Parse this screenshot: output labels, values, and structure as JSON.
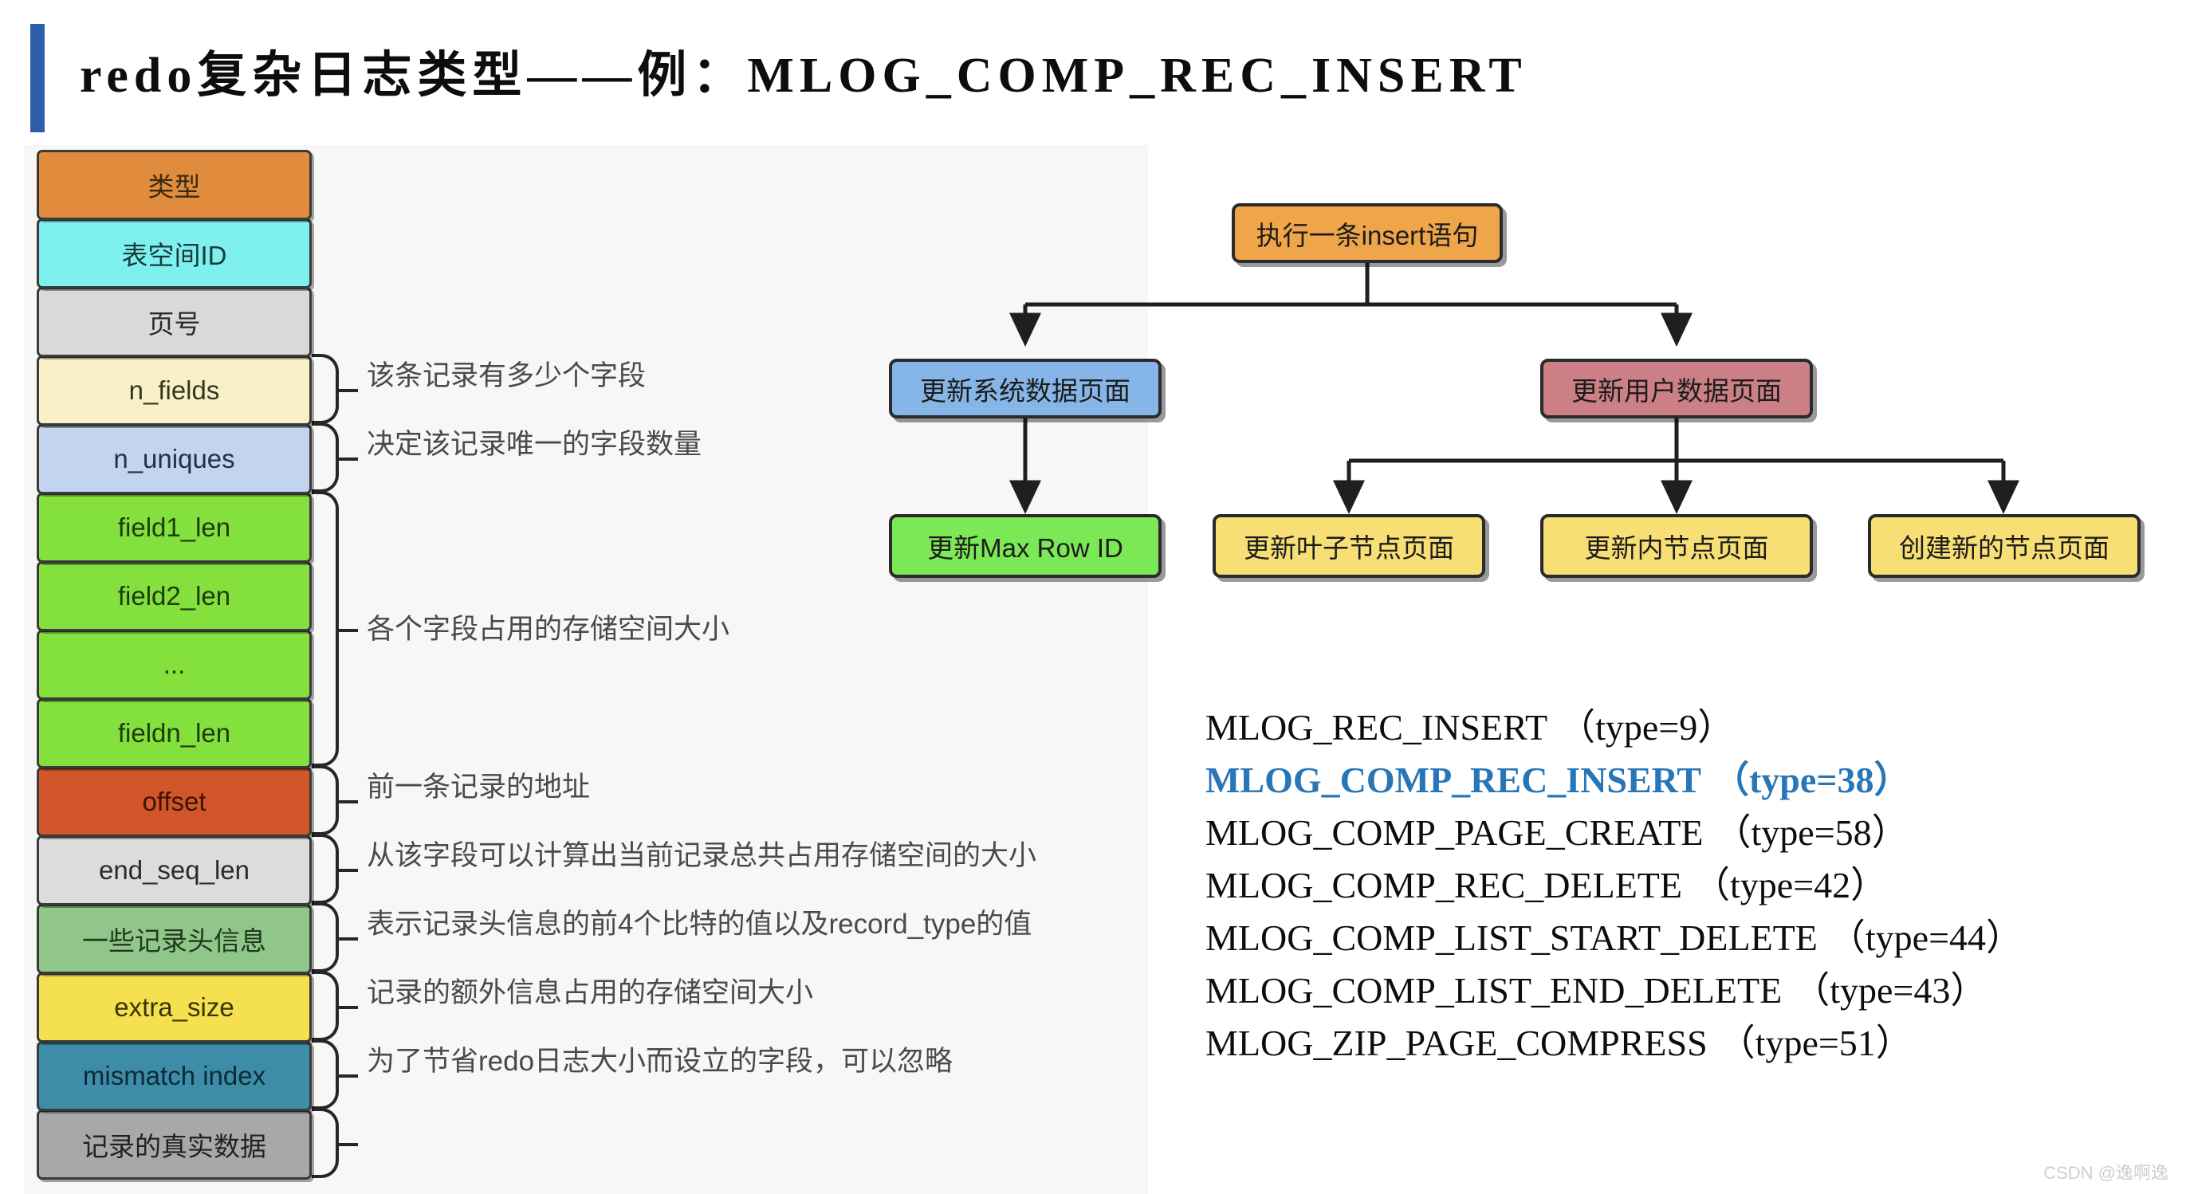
{
  "title": "redo复杂日志类型——例：MLOG_COMP_REC_INSERT",
  "accent_color": "#2D5DA8",
  "record_format": {
    "fields": [
      {
        "label": "类型",
        "color": "#E08C3C",
        "text_color": "#3a2a12"
      },
      {
        "label": "表空间ID",
        "color": "#7FF0F0",
        "text_color": "#183a3a"
      },
      {
        "label": "页号",
        "color": "#D9D9D9",
        "text_color": "#2a2a2a"
      },
      {
        "label": "n_fields",
        "color": "#F7F0C8",
        "text_color": "#3a3520"
      },
      {
        "label": "n_uniques",
        "color": "#C2D4EE",
        "text_color": "#20304a"
      },
      {
        "label": "field1_len",
        "color": "#84E03C",
        "text_color": "#1e3a10"
      },
      {
        "label": "field2_len",
        "color": "#84E03C",
        "text_color": "#1e3a10"
      },
      {
        "label": "...",
        "color": "#84E03C",
        "text_color": "#1e3a10"
      },
      {
        "label": "fieldn_len",
        "color": "#84E03C",
        "text_color": "#1e3a10"
      },
      {
        "label": "offset",
        "color": "#D2562A",
        "text_color": "#3a1406"
      },
      {
        "label": "end_seq_len",
        "color": "#DCDCDC",
        "text_color": "#2a2a2a"
      },
      {
        "label": "一些记录头信息",
        "color": "#90C68A",
        "text_color": "#1f3a1c"
      },
      {
        "label": "extra_size",
        "color": "#F5E050",
        "text_color": "#3a3508"
      },
      {
        "label": "mismatch index",
        "color": "#3D8DA8",
        "text_color": "#0d2a36"
      },
      {
        "label": "记录的真实数据",
        "color": "#A8A8A8",
        "text_color": "#222222"
      }
    ],
    "annotations": [
      {
        "field": "n_fields",
        "text": "该条记录有多少个字段"
      },
      {
        "field": "n_uniques",
        "text": "决定该记录唯一的字段数量"
      },
      {
        "field": "fieldN_len",
        "text": "各个字段占用的存储空间大小"
      },
      {
        "field": "offset",
        "text": "前一条记录的地址"
      },
      {
        "field": "end_seq_len",
        "text": "从该字段可以计算出当前记录总共占用存储空间的大小"
      },
      {
        "field": "record_header",
        "text": "表示记录头信息的前4个比特的值以及record_type的值"
      },
      {
        "field": "extra_size",
        "text": "记录的额外信息占用的存储空间大小"
      },
      {
        "field": "mismatch index",
        "text": "为了节省redo日志大小而设立的字段，可以忽略"
      }
    ]
  },
  "flowchart": {
    "nodes": [
      {
        "id": "exec-insert",
        "label": "执行一条insert语句",
        "color": "#EFA54A"
      },
      {
        "id": "update-system",
        "label": "更新系统数据页面",
        "color": "#86B6E8"
      },
      {
        "id": "update-user",
        "label": "更新用户数据页面",
        "color": "#CC8086"
      },
      {
        "id": "update-max-row",
        "label": "更新Max Row ID",
        "color": "#7CE855"
      },
      {
        "id": "update-leaf",
        "label": "更新叶子节点页面",
        "color": "#F7DE75"
      },
      {
        "id": "update-inner",
        "label": "更新内节点页面",
        "color": "#F7DE75"
      },
      {
        "id": "create-new-node",
        "label": "创建新的节点页面",
        "color": "#F7DE75"
      }
    ],
    "edges": [
      {
        "from": "exec-insert",
        "to": "update-system"
      },
      {
        "from": "exec-insert",
        "to": "update-user"
      },
      {
        "from": "update-system",
        "to": "update-max-row"
      },
      {
        "from": "update-user",
        "to": "update-leaf"
      },
      {
        "from": "update-user",
        "to": "update-inner"
      },
      {
        "from": "update-user",
        "to": "create-new-node"
      }
    ]
  },
  "mlog_types": [
    {
      "name": "MLOG_REC_INSERT",
      "type": "（type=9）",
      "highlight": false
    },
    {
      "name": "MLOG_COMP_REC_INSERT",
      "type": "（type=38）",
      "highlight": true
    },
    {
      "name": "MLOG_COMP_PAGE_CREATE",
      "type": "（type=58）",
      "highlight": false
    },
    {
      "name": "MLOG_COMP_REC_DELETE",
      "type": "（type=42）",
      "highlight": false
    },
    {
      "name": "MLOG_COMP_LIST_START_DELETE",
      "type": "（type=44）",
      "highlight": false
    },
    {
      "name": "MLOG_COMP_LIST_END_DELETE",
      "type": "（type=43）",
      "highlight": false
    },
    {
      "name": "MLOG_ZIP_PAGE_COMPRESS",
      "type": "（type=51）",
      "highlight": false
    }
  ],
  "highlight_color": "#2776B8",
  "watermark": "CSDN @逸啊逸"
}
